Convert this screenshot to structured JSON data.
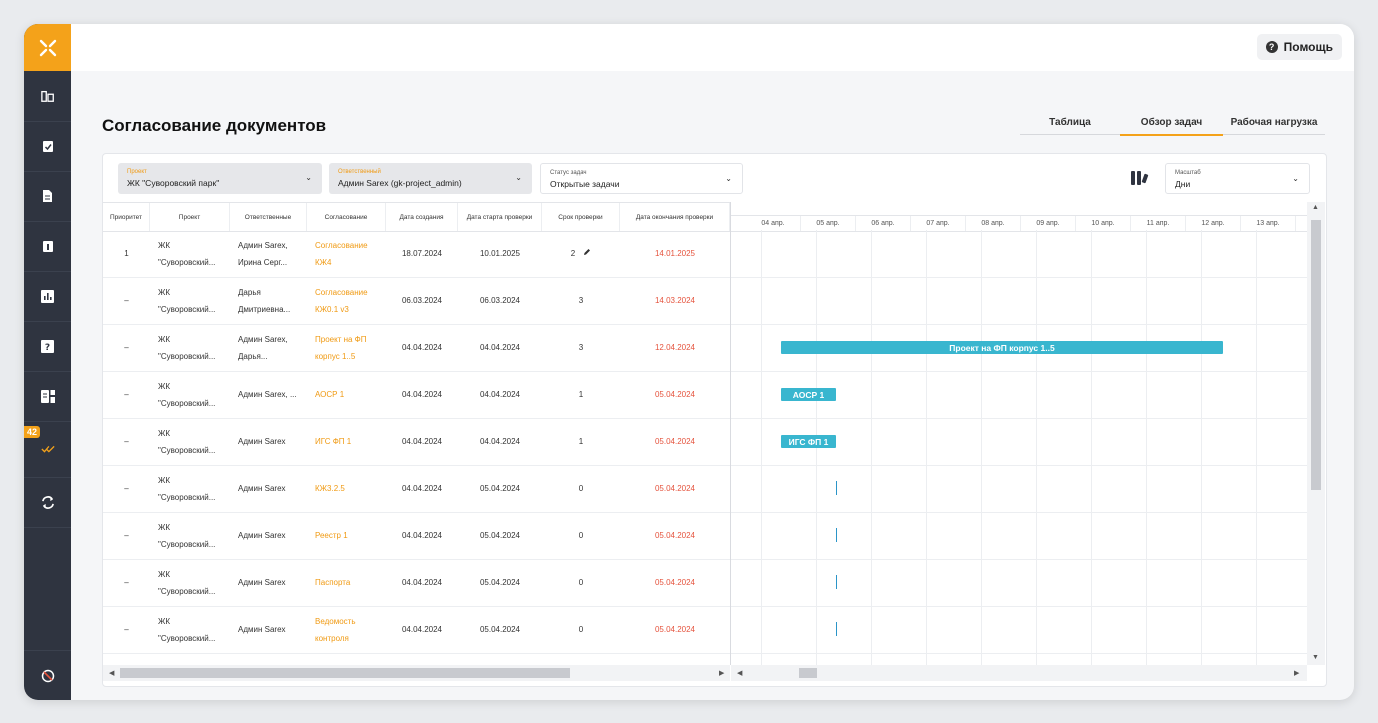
{
  "topbar": {
    "help_label": "Помощь"
  },
  "page": {
    "title": "Согласование документов"
  },
  "view_tabs": [
    {
      "label": "Таблица",
      "active": false
    },
    {
      "label": "Обзор задач",
      "active": true
    },
    {
      "label": "Рабочая нагрузка",
      "active": false
    }
  ],
  "sidebar": {
    "badge": "42"
  },
  "filters": {
    "project": {
      "label": "Проект",
      "value": "ЖК \"Суворовский парк\""
    },
    "responsible": {
      "label": "Ответственный",
      "value": "Админ Sarex (gk-project_admin)"
    },
    "status": {
      "label": "Статус задач",
      "value": "Открытые задачи"
    },
    "scale": {
      "label": "Масштаб",
      "value": "Дни"
    }
  },
  "table": {
    "columns": [
      "Приоритет",
      "Проект",
      "Ответственные",
      "Согласование",
      "Дата создания",
      "Дата старта проверки",
      "Срок проверки",
      "Дата окончания проверки"
    ],
    "rows": [
      {
        "priority": "1",
        "project": [
          "ЖК",
          "\"Суворовский..."
        ],
        "responsible": [
          "Админ Sarex,",
          "Ирина Серг..."
        ],
        "approval": [
          "Согласование",
          "КЖ4"
        ],
        "created": "18.07.2024",
        "start": "10.01.2025",
        "term": "2",
        "end": "14.01.2025"
      },
      {
        "priority": "–",
        "project": [
          "ЖК",
          "\"Суворовский..."
        ],
        "responsible": [
          "Дарья",
          "Дмитриевна..."
        ],
        "approval": [
          "Согласование",
          "КЖ0.1 v3"
        ],
        "created": "06.03.2024",
        "start": "06.03.2024",
        "term": "3",
        "end": "14.03.2024"
      },
      {
        "priority": "–",
        "project": [
          "ЖК",
          "\"Суворовский..."
        ],
        "responsible": [
          "Админ Sarex,",
          "Дарья..."
        ],
        "approval": [
          "Проект на ФП",
          "корпус 1..5"
        ],
        "created": "04.04.2024",
        "start": "04.04.2024",
        "term": "3",
        "end": "12.04.2024"
      },
      {
        "priority": "–",
        "project": [
          "ЖК",
          "\"Суворовский..."
        ],
        "responsible": [
          "Админ Sarex, ..."
        ],
        "approval": [
          "АОСР 1"
        ],
        "created": "04.04.2024",
        "start": "04.04.2024",
        "term": "1",
        "end": "05.04.2024"
      },
      {
        "priority": "–",
        "project": [
          "ЖК",
          "\"Суворовский..."
        ],
        "responsible": [
          "Админ Sarex"
        ],
        "approval": [
          "ИГС ФП 1"
        ],
        "created": "04.04.2024",
        "start": "04.04.2024",
        "term": "1",
        "end": "05.04.2024"
      },
      {
        "priority": "–",
        "project": [
          "ЖК",
          "\"Суворовский..."
        ],
        "responsible": [
          "Админ Sarex"
        ],
        "approval": [
          "КЖ3.2.5"
        ],
        "created": "04.04.2024",
        "start": "05.04.2024",
        "term": "0",
        "end": "05.04.2024"
      },
      {
        "priority": "–",
        "project": [
          "ЖК",
          "\"Суворовский..."
        ],
        "responsible": [
          "Админ Sarex"
        ],
        "approval": [
          "Реестр 1"
        ],
        "created": "04.04.2024",
        "start": "05.04.2024",
        "term": "0",
        "end": "05.04.2024"
      },
      {
        "priority": "–",
        "project": [
          "ЖК",
          "\"Суворовский..."
        ],
        "responsible": [
          "Админ Sarex"
        ],
        "approval": [
          "Паспорта"
        ],
        "created": "04.04.2024",
        "start": "05.04.2024",
        "term": "0",
        "end": "05.04.2024"
      },
      {
        "priority": "–",
        "project": [
          "ЖК",
          "\"Суворовский..."
        ],
        "responsible": [
          "Админ Sarex"
        ],
        "approval": [
          "Ведомость",
          "контроля"
        ],
        "created": "04.04.2024",
        "start": "05.04.2024",
        "term": "0",
        "end": "05.04.2024"
      }
    ]
  },
  "gantt": {
    "days": [
      "04 апр.",
      "05 апр.",
      "06 апр.",
      "07 апр.",
      "08 апр.",
      "09 апр.",
      "10 апр.",
      "11 апр.",
      "12 апр.",
      "13 апр."
    ],
    "bars": [
      {
        "row": 2,
        "label": "Проект на ФП корпус 1..5",
        "start": "04 апр.",
        "end": "12 апр."
      },
      {
        "row": 3,
        "label": "АОСР 1",
        "start": "04 апр.",
        "end": "05 апр."
      },
      {
        "row": 4,
        "label": "ИГС ФП 1",
        "start": "04 апр.",
        "end": "05 апр."
      }
    ],
    "milestones": [
      5,
      6,
      7,
      8
    ]
  }
}
